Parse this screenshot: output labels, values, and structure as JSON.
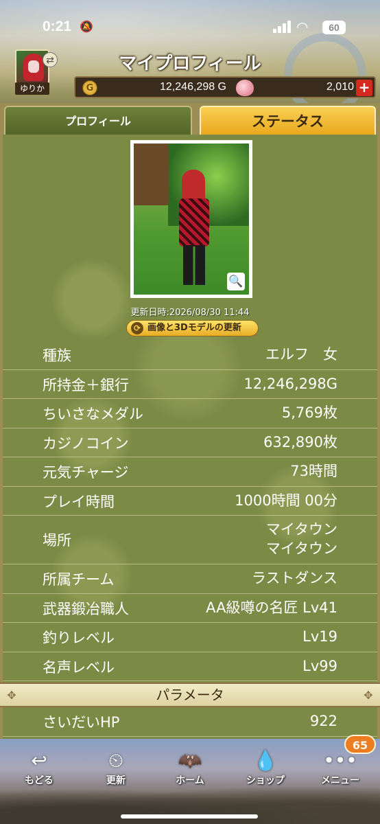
{
  "status_bar": {
    "time": "0:21",
    "battery": "60"
  },
  "header": {
    "title": "マイプロフィール",
    "player_name": "ゆりか",
    "gold": "12,246,298 G",
    "gems": "2,010",
    "plus": "+"
  },
  "tabs": [
    {
      "label": "プロフィール",
      "active": false
    },
    {
      "label": "ステータス",
      "active": true
    }
  ],
  "profile": {
    "updated": "更新日時:2026/08/30 11:44",
    "update_button": "画像と3Dモデルの更新"
  },
  "stats": [
    {
      "label": "種族",
      "value": "エルフ　女"
    },
    {
      "label": "所持金＋銀行",
      "value": "12,246,298G"
    },
    {
      "label": "ちいさなメダル",
      "value": "5,769枚"
    },
    {
      "label": "カジノコイン",
      "value": "632,890枚"
    },
    {
      "label": "元気チャージ",
      "value": "73時間"
    },
    {
      "label": "プレイ時間",
      "value": "1000時間 00分"
    },
    {
      "label": "場所",
      "value": "マイタウン",
      "value2": "マイタウン"
    },
    {
      "label": "所属チーム",
      "value": "ラストダンス"
    },
    {
      "label": "武器鍛冶職人",
      "value": "AA級噂の名匠 Lv41"
    },
    {
      "label": "釣りレベル",
      "value": "Lv19"
    },
    {
      "label": "名声レベル",
      "value": "Lv99"
    }
  ],
  "parameters": {
    "section_title": "パラメータ",
    "rows": [
      {
        "label": "さいだいHP",
        "value": "922"
      }
    ]
  },
  "nav": {
    "back": "もどる",
    "refresh": "更新",
    "home": "ホーム",
    "shop": "ショップ",
    "menu": "メニュー",
    "menu_badge": "65"
  }
}
